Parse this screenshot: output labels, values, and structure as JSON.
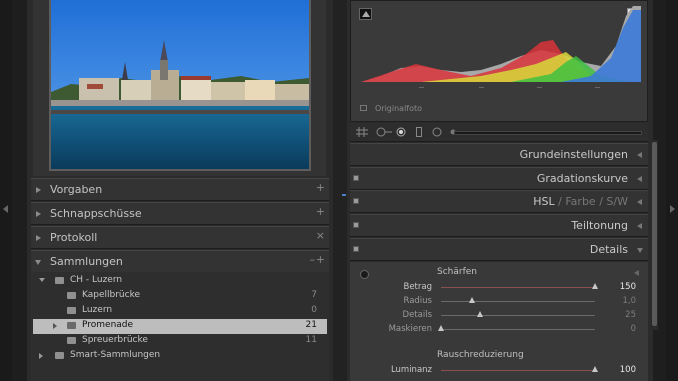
{
  "left": {
    "sections": [
      {
        "label": "Vorgaben"
      },
      {
        "label": "Schnappschüsse"
      },
      {
        "label": "Protokoll"
      },
      {
        "label": "Sammlungen"
      }
    ],
    "section_plus": "+",
    "section_x": "×",
    "section_minus": "–",
    "collections": [
      {
        "name": "CH - Luzern",
        "count": ""
      },
      {
        "name": "Kapellbrücke",
        "count": "7"
      },
      {
        "name": "Luzern",
        "count": "0"
      },
      {
        "name": "Promenade",
        "count": "21"
      },
      {
        "name": "Spreuerbrücke",
        "count": "11"
      },
      {
        "name": "Smart-Sammlungen",
        "count": ""
      }
    ]
  },
  "histogram": {
    "caption": "Originalfoto",
    "colors": {
      "red": "#d9343a",
      "yellow": "#d8d83a",
      "green": "#3fbf3f",
      "blue": "#3c7ad8",
      "gray": "#a8a8a8"
    }
  },
  "right": {
    "panels": [
      {
        "label": "Grundeinstellungen"
      },
      {
        "label": "Gradationskurve"
      },
      {
        "label_hsl": "HSL",
        "sep": "/",
        "label_farbe": "Farbe",
        "label_sw": "S/W"
      },
      {
        "label": "Teiltonung"
      },
      {
        "label": "Details"
      }
    ],
    "details": {
      "sharpen_title": "Schärfen",
      "sliders": [
        {
          "label": "Betrag",
          "value": "150",
          "fraction": 1.0
        },
        {
          "label": "Radius",
          "value": "1,0",
          "fraction": 0.2
        },
        {
          "label": "Details",
          "value": "25",
          "fraction": 0.25
        },
        {
          "label": "Maskieren",
          "value": "0",
          "fraction": 0.0
        }
      ],
      "noise_title": "Rauschreduzierung",
      "noise_sliders": [
        {
          "label": "Luminanz",
          "value": "100",
          "fraction": 1.0
        }
      ]
    }
  }
}
